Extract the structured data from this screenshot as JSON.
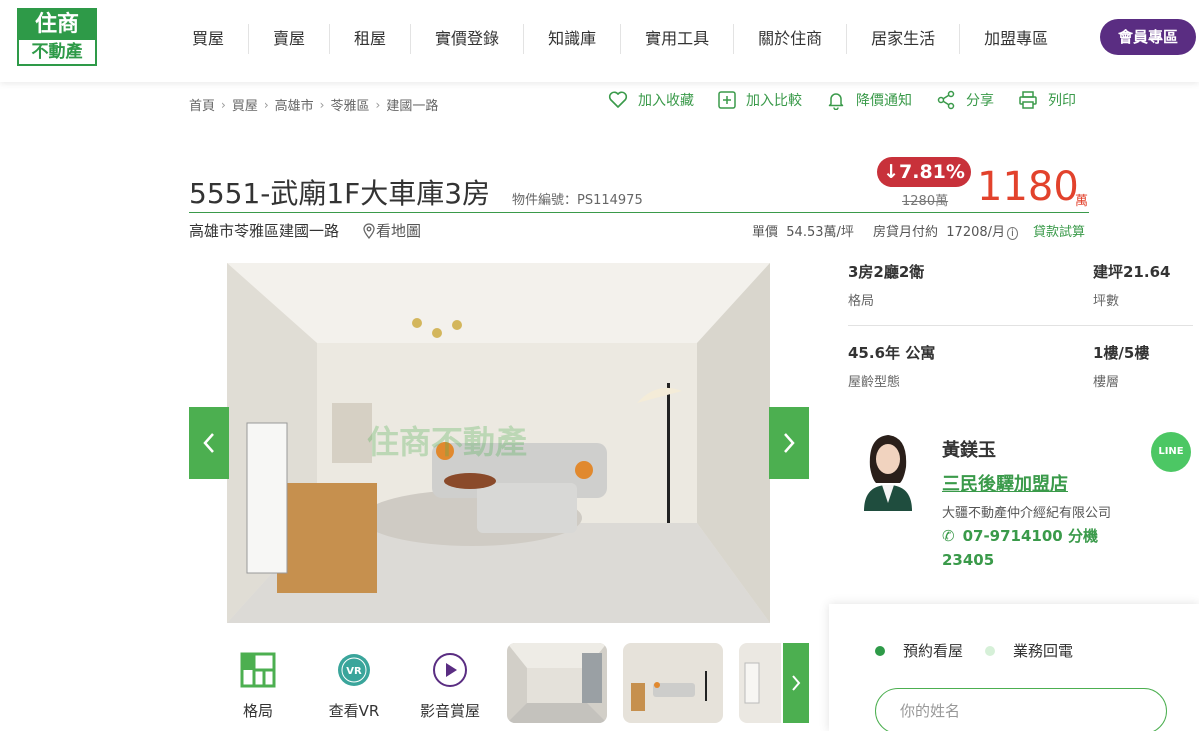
{
  "logo": {
    "top": "住商",
    "bottom": "不動產"
  },
  "nav": [
    "買屋",
    "賣屋",
    "租屋",
    "實價登錄",
    "知識庫",
    "實用工具",
    "關於住商",
    "居家生活",
    "加盟專區"
  ],
  "member_button": "會員專區",
  "breadcrumb": [
    "首頁",
    "買屋",
    "高雄市",
    "苓雅區",
    "建國一路"
  ],
  "actions": {
    "favorite": "加入收藏",
    "compare": "加入比較",
    "price_alert": "降價通知",
    "share": "分享",
    "print": "列印"
  },
  "listing": {
    "title": "5551-武廟1F大車庫3房",
    "object_no": "物件編號：PS114975",
    "discount": "7.81%",
    "old_price": "1280萬",
    "price": "1180",
    "price_unit": "萬",
    "address": "高雄市苓雅區建國一路",
    "map_link": "看地圖",
    "unit_price_label": "單價",
    "unit_price": "54.53萬/坪",
    "monthly_label": "房貸月付約",
    "monthly": "17208/月",
    "loan_calc": "貸款試算"
  },
  "tools": {
    "floorplan": "格局",
    "vr": "查看VR",
    "video": "影音賞屋",
    "vr_badge": "VR"
  },
  "photo": {
    "watermark": "住商不動產"
  },
  "specs": [
    {
      "value": "3房2廳2衛",
      "label": "格局"
    },
    {
      "value": "建坪21.64",
      "label": "坪數"
    },
    {
      "value": "45.6年 公寓",
      "label": "屋齡型態"
    },
    {
      "value": "1樓/5樓",
      "label": "樓層"
    }
  ],
  "agent": {
    "name": "黃鎂玉",
    "store": "三民後驛加盟店",
    "company": "大疆不動產仲介經紀有限公司",
    "phone": "07-9714100 分機 23405",
    "line": "LINE"
  },
  "contact": {
    "tab_visit": "預約看屋",
    "tab_callback": "業務回電",
    "name_placeholder": "你的姓名"
  },
  "colors": {
    "brand_green": "#3a9a4a",
    "price_red": "#e2422c",
    "member_purple": "#5a2d82",
    "discount_red": "#c8313a"
  }
}
